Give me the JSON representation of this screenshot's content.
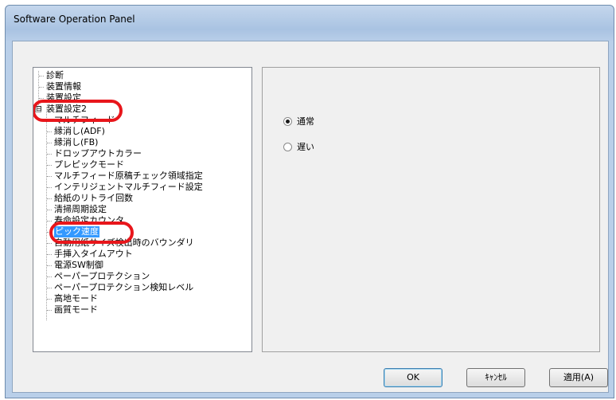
{
  "window": {
    "title": "Software Operation Panel"
  },
  "tree": {
    "items": [
      {
        "label": "診断"
      },
      {
        "label": "装置情報"
      },
      {
        "label": "装置設定"
      },
      {
        "label": "装置設定2",
        "expander": "⊟"
      },
      {
        "label": "マルチフィード"
      },
      {
        "label": "縁消し(ADF)"
      },
      {
        "label": "縁消し(FB)"
      },
      {
        "label": "ドロップアウトカラー"
      },
      {
        "label": "プレピックモード"
      },
      {
        "label": "マルチフィード原稿チェック領域指定"
      },
      {
        "label": "インテリジェントマルチフィード設定"
      },
      {
        "label": "給紙のリトライ回数"
      },
      {
        "label": "清掃周期設定"
      },
      {
        "label": "寿命設定カウンタ"
      },
      {
        "label": "ピック速度",
        "selected": true
      },
      {
        "label": "自動用紙サイズ検出時のバウンダリ"
      },
      {
        "label": "手挿入タイムアウト"
      },
      {
        "label": "電源SW制御"
      },
      {
        "label": "ペーパープロテクション"
      },
      {
        "label": "ペーパープロテクション検知レベル"
      },
      {
        "label": "高地モード"
      },
      {
        "label": "画質モード"
      }
    ]
  },
  "options": {
    "normal": {
      "label": "通常",
      "checked": true
    },
    "slow": {
      "label": "遅い",
      "checked": false
    }
  },
  "buttons": {
    "ok": "OK",
    "cancel": "ｷｬﾝｾﾙ",
    "apply": "適用(A)"
  },
  "colors": {
    "highlight": "#e8161b",
    "selection": "#3399ff"
  }
}
